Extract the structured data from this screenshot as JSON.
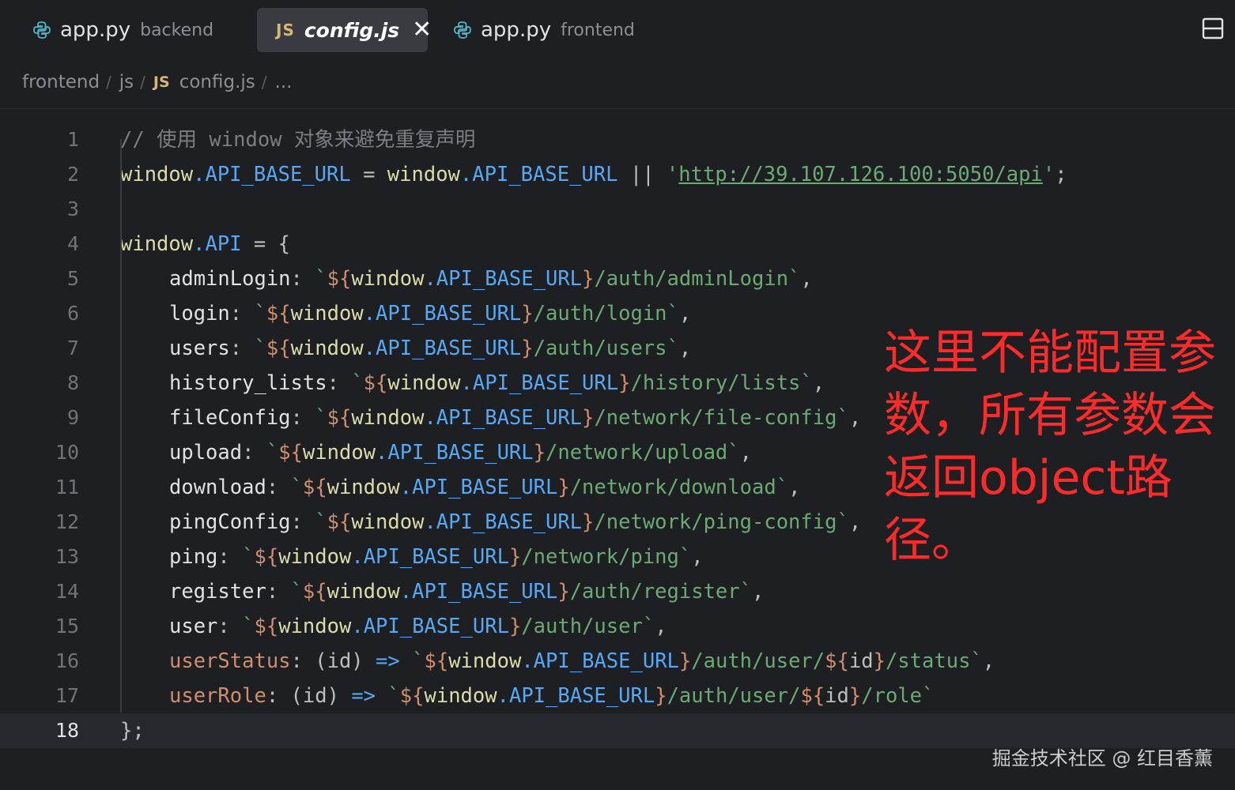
{
  "tabs": [
    {
      "name": "app.py",
      "hint": "backend",
      "icon": "python-icon"
    },
    {
      "name": "config.js",
      "badge": "JS",
      "icon": "javascript-icon",
      "active": true
    },
    {
      "name": "app.py",
      "hint": "frontend",
      "icon": "python-icon"
    }
  ],
  "breadcrumb": {
    "parts": [
      "frontend",
      "js",
      "config.js",
      "..."
    ],
    "badge": "JS",
    "separator": "/"
  },
  "editor": {
    "current_line": 18,
    "line_numbers": [
      "1",
      "2",
      "3",
      "4",
      "5",
      "6",
      "7",
      "8",
      "9",
      "10",
      "11",
      "12",
      "13",
      "14",
      "15",
      "16",
      "17",
      "18"
    ],
    "lines": {
      "l1_comment": "// 使用 window 对象来避免重复声明",
      "l2_a": "window",
      "l2_b": ".API_BASE_URL",
      "l2_c": " = ",
      "l2_d": "window",
      "l2_e": ".API_BASE_URL",
      "l2_f": " || ",
      "l2_q1": "'",
      "l2_url": "http://39.107.126.100:5050/api",
      "l2_q2": "'",
      "l2_end": ";",
      "l4_a": "window",
      "l4_b": ".API",
      "l4_c": " = {",
      "entries": [
        {
          "key": "adminLogin",
          "path": "/auth/adminLogin"
        },
        {
          "key": "login",
          "path": "/auth/login"
        },
        {
          "key": "users",
          "path": "/auth/users"
        },
        {
          "key": "history_lists",
          "path": "/history/lists"
        },
        {
          "key": "fileConfig",
          "path": "/network/file-config"
        },
        {
          "key": "upload",
          "path": "/network/upload"
        },
        {
          "key": "download",
          "path": "/network/download"
        },
        {
          "key": "pingConfig",
          "path": "/network/ping-config"
        },
        {
          "key": "ping",
          "path": "/network/ping"
        },
        {
          "key": "register",
          "path": "/auth/register"
        },
        {
          "key": "user",
          "path": "/auth/user"
        }
      ],
      "l16_key": "userStatus",
      "l16_param": "(id)",
      "l16_p1": "/auth/user/",
      "l16_p2": "/status",
      "l17_key": "userRole",
      "l17_param": "(id)",
      "l17_p1": "/auth/user/",
      "l17_p2": "/role",
      "interp_open": "${",
      "interp_win": "window",
      "interp_prop": ".API_BASE_URL",
      "interp_close": "}",
      "id_var": "id",
      "l18": "};"
    }
  },
  "annotation": {
    "text": "这里不能配置参数，所有参数会返回object路径。",
    "color": "#ff2b2b"
  },
  "watermark": "掘金技术社区 @ 红目香薰",
  "colors": {
    "background": "#1e1f22",
    "active_tab": "#393b40",
    "js_badge": "#d5b778",
    "string": "#6aab73",
    "property": "#56a8f5"
  }
}
